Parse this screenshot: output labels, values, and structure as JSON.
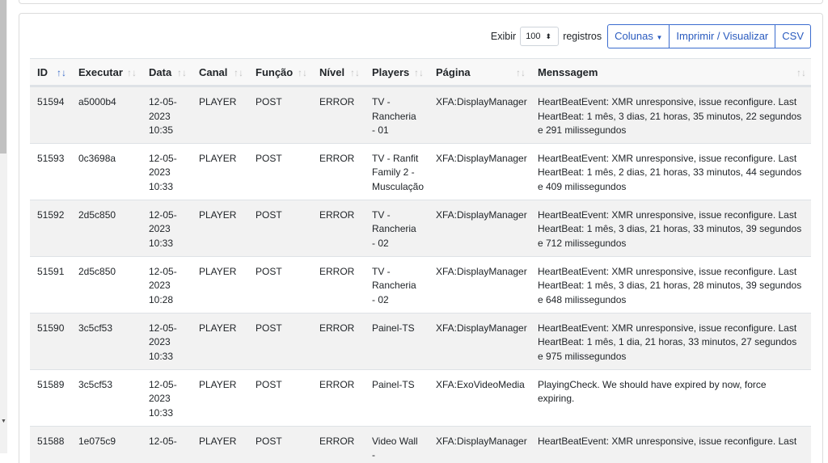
{
  "toolbar": {
    "show_label": "Exibir",
    "page_size": "100",
    "records_label": "registros",
    "columns_button": "Colunas",
    "print_button": "Imprimir / Visualizar",
    "csv_button": "CSV"
  },
  "columns": [
    "ID",
    "Executar",
    "Data",
    "Canal",
    "Função",
    "Nível",
    "Players",
    "Página",
    "Menssagem"
  ],
  "rows": [
    {
      "id": "51594",
      "exec": "a5000b4",
      "date": "12-05-2023 10:35",
      "canal": "PLAYER",
      "funcao": "POST",
      "nivel": "ERROR",
      "players": "TV - Rancheria - 01",
      "pagina": "XFA:DisplayManager",
      "msg": "HeartBeatEvent: XMR unresponsive, issue reconfigure. Last HeartBeat: 1 mês, 3 dias, 21 horas, 35 minutos, 22 segundos e 291 milissegundos"
    },
    {
      "id": "51593",
      "exec": "0c3698a",
      "date": "12-05-2023 10:33",
      "canal": "PLAYER",
      "funcao": "POST",
      "nivel": "ERROR",
      "players": "TV - Ranfit Family 2 - Musculação",
      "pagina": "XFA:DisplayManager",
      "msg": "HeartBeatEvent: XMR unresponsive, issue reconfigure. Last HeartBeat: 1 mês, 2 dias, 21 horas, 33 minutos, 44 segundos e 409 milissegundos"
    },
    {
      "id": "51592",
      "exec": "2d5c850",
      "date": "12-05-2023 10:33",
      "canal": "PLAYER",
      "funcao": "POST",
      "nivel": "ERROR",
      "players": "TV - Rancheria - 02",
      "pagina": "XFA:DisplayManager",
      "msg": "HeartBeatEvent: XMR unresponsive, issue reconfigure. Last HeartBeat: 1 mês, 3 dias, 21 horas, 33 minutos, 39 segundos e 712 milissegundos"
    },
    {
      "id": "51591",
      "exec": "2d5c850",
      "date": "12-05-2023 10:28",
      "canal": "PLAYER",
      "funcao": "POST",
      "nivel": "ERROR",
      "players": "TV - Rancheria - 02",
      "pagina": "XFA:DisplayManager",
      "msg": "HeartBeatEvent: XMR unresponsive, issue reconfigure. Last HeartBeat: 1 mês, 3 dias, 21 horas, 28 minutos, 39 segundos e 648 milissegundos"
    },
    {
      "id": "51590",
      "exec": "3c5cf53",
      "date": "12-05-2023 10:33",
      "canal": "PLAYER",
      "funcao": "POST",
      "nivel": "ERROR",
      "players": "Painel-TS",
      "pagina": "XFA:DisplayManager",
      "msg": "HeartBeatEvent: XMR unresponsive, issue reconfigure. Last HeartBeat: 1 mês, 1 dia, 21 horas, 33 minutos, 27 segundos e 975 milissegundos"
    },
    {
      "id": "51589",
      "exec": "3c5cf53",
      "date": "12-05-2023 10:33",
      "canal": "PLAYER",
      "funcao": "POST",
      "nivel": "ERROR",
      "players": "Painel-TS",
      "pagina": "XFA:ExoVideoMedia",
      "msg": "PlayingCheck. We should have expired by now, force expiring."
    },
    {
      "id": "51588",
      "exec": "1e075c9",
      "date": "12-05-",
      "canal": "PLAYER",
      "funcao": "POST",
      "nivel": "ERROR",
      "players": "Video Wall -",
      "pagina": "XFA:DisplayManager",
      "msg": "HeartBeatEvent: XMR unresponsive, issue reconfigure. Last"
    }
  ]
}
